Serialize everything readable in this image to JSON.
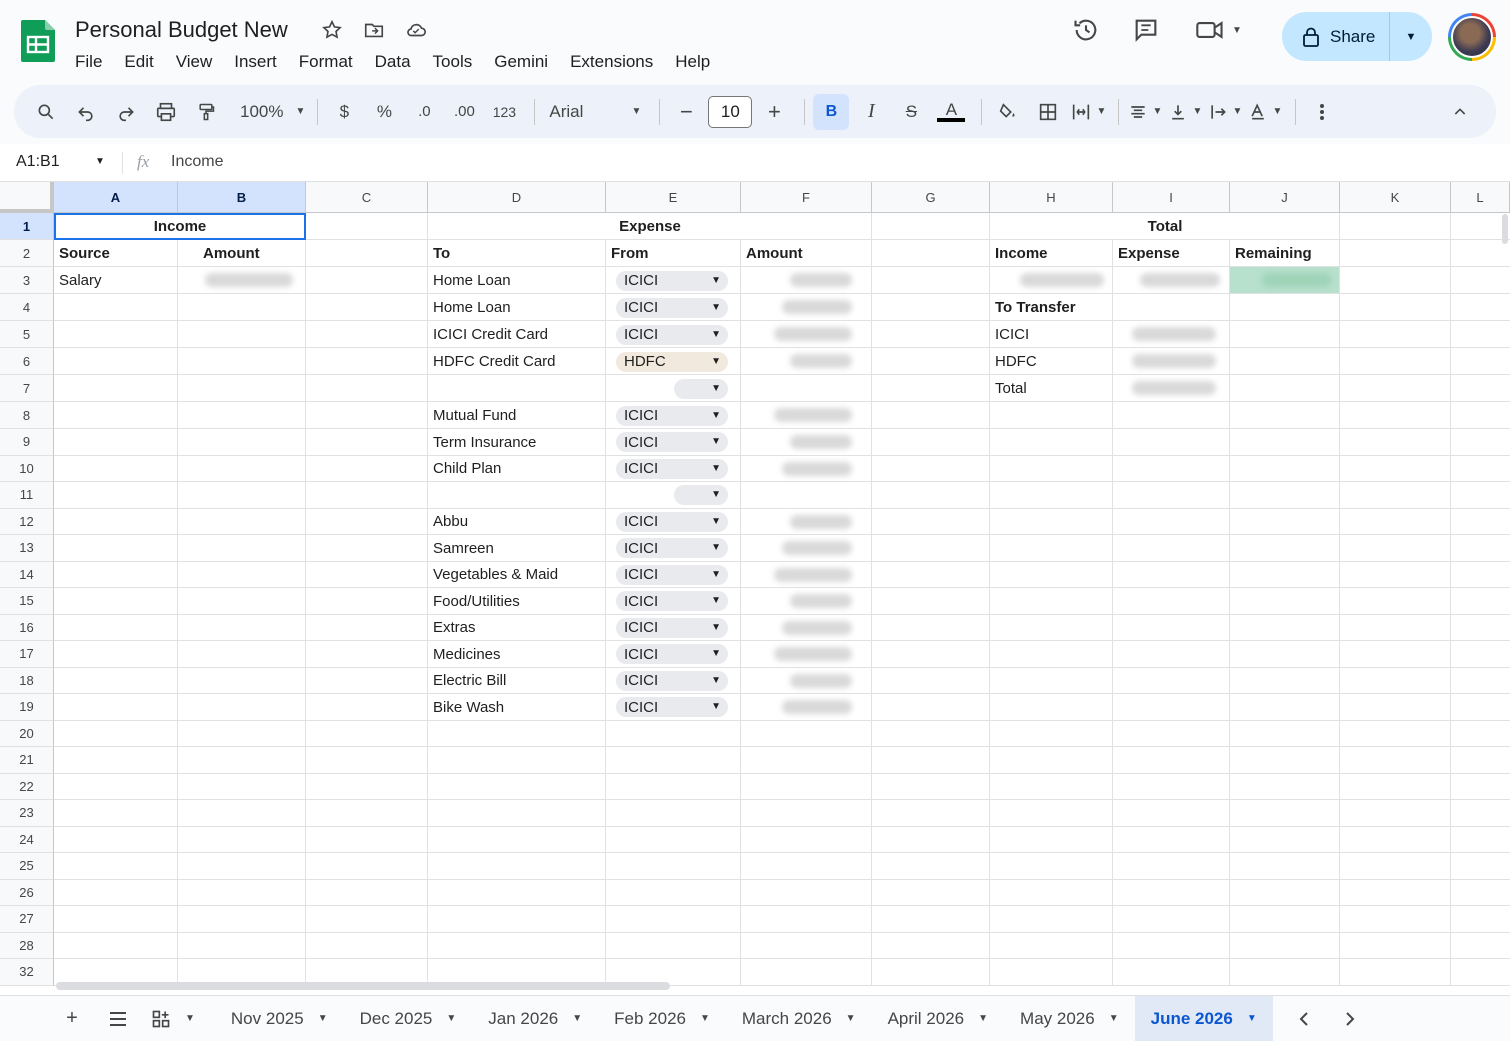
{
  "doc": {
    "title": "Personal Budget New"
  },
  "menu": [
    "File",
    "Edit",
    "View",
    "Insert",
    "Format",
    "Data",
    "Tools",
    "Gemini",
    "Extensions",
    "Help"
  ],
  "header_right": {
    "share_label": "Share"
  },
  "toolbar": {
    "zoom": "100%",
    "currency": "$",
    "percent": "%",
    "dec_decrease": ".0",
    "dec_increase": ".00",
    "number_format": "123",
    "font": "Arial",
    "font_size": "10",
    "bold": "B",
    "italic": "I",
    "strike": "S",
    "text_color": "A"
  },
  "formula_bar": {
    "name_box": "A1:B1",
    "formula": "Income"
  },
  "columns": [
    "A",
    "B",
    "C",
    "D",
    "E",
    "F",
    "G",
    "H",
    "I",
    "J",
    "K",
    "L"
  ],
  "rows": [
    "1",
    "2",
    "3",
    "4",
    "5",
    "6",
    "7",
    "8",
    "9",
    "10",
    "11",
    "12",
    "13",
    "14",
    "15",
    "16",
    "17",
    "18",
    "19",
    "20",
    "21",
    "22",
    "23",
    "24",
    "25",
    "26",
    "27",
    "28",
    "32"
  ],
  "sheet": {
    "income_header": "Income",
    "expense_header": "Expense",
    "total_header": "Total",
    "col_source": "Source",
    "col_amount": "Amount",
    "col_to": "To",
    "col_from": "From",
    "col_amount2": "Amount",
    "col_income": "Income",
    "col_expense": "Expense",
    "col_remaining": "Remaining",
    "salary": "Salary",
    "to_transfer": "To Transfer",
    "transfer_icici": "ICICI",
    "transfer_hdfc": "HDFC",
    "transfer_total": "Total",
    "expenses": [
      {
        "to": "Home Loan",
        "from": "ICICI"
      },
      {
        "to": "Home Loan",
        "from": "ICICI"
      },
      {
        "to": "ICICI Credit Card",
        "from": "ICICI"
      },
      {
        "to": "HDFC Credit Card",
        "from": "HDFC"
      },
      {
        "to": "",
        "from": ""
      },
      {
        "to": "Mutual Fund",
        "from": "ICICI"
      },
      {
        "to": "Term Insurance",
        "from": "ICICI"
      },
      {
        "to": "Child Plan",
        "from": "ICICI"
      },
      {
        "to": "",
        "from": ""
      },
      {
        "to": "Abbu",
        "from": "ICICI"
      },
      {
        "to": "Samreen",
        "from": "ICICI"
      },
      {
        "to": "Vegetables & Maid",
        "from": "ICICI"
      },
      {
        "to": "Food/Utilities",
        "from": "ICICI"
      },
      {
        "to": "Extras",
        "from": "ICICI"
      },
      {
        "to": "Medicines",
        "from": "ICICI"
      },
      {
        "to": "Electric Bill",
        "from": "ICICI"
      },
      {
        "to": "Bike Wash",
        "from": "ICICI"
      }
    ]
  },
  "tabs": [
    "Nov 2025",
    "Dec 2025",
    "Jan 2026",
    "Feb 2026",
    "March 2026",
    "April 2026",
    "May 2026",
    "June 2026"
  ],
  "active_tab": "June 2026",
  "colors": {
    "accent": "#0b57d0",
    "share_bg": "#c2e7ff",
    "selection": "#1a73e8",
    "remaining_fill": "#b7e1cd"
  }
}
